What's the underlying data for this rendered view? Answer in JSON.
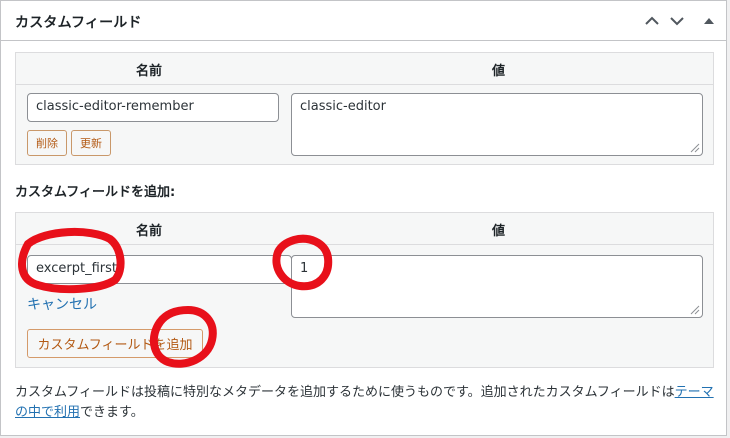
{
  "panel": {
    "title": "カスタムフィールド"
  },
  "existing": {
    "name_header": "名前",
    "value_header": "値",
    "name_value": "classic-editor-remember",
    "value_value": "classic-editor",
    "delete_label": "削除",
    "update_label": "更新"
  },
  "add_new": {
    "section_label": "カスタムフィールドを追加:",
    "name_header": "名前",
    "value_header": "値",
    "name_value": "excerpt_first",
    "value_value": "1",
    "cancel_label": "キャンセル",
    "add_button_label": "カスタムフィールドを追加"
  },
  "description": {
    "text_before": "カスタムフィールドは投稿に特別なメタデータを追加するために使うものです。追加されたカスタムフィールドは",
    "link_text": "テーマの中で利用",
    "text_after": "できます。"
  },
  "colors": {
    "accent_link": "#2271b1",
    "button_text": "#b35a14",
    "annotation_red": "#e8101a"
  }
}
